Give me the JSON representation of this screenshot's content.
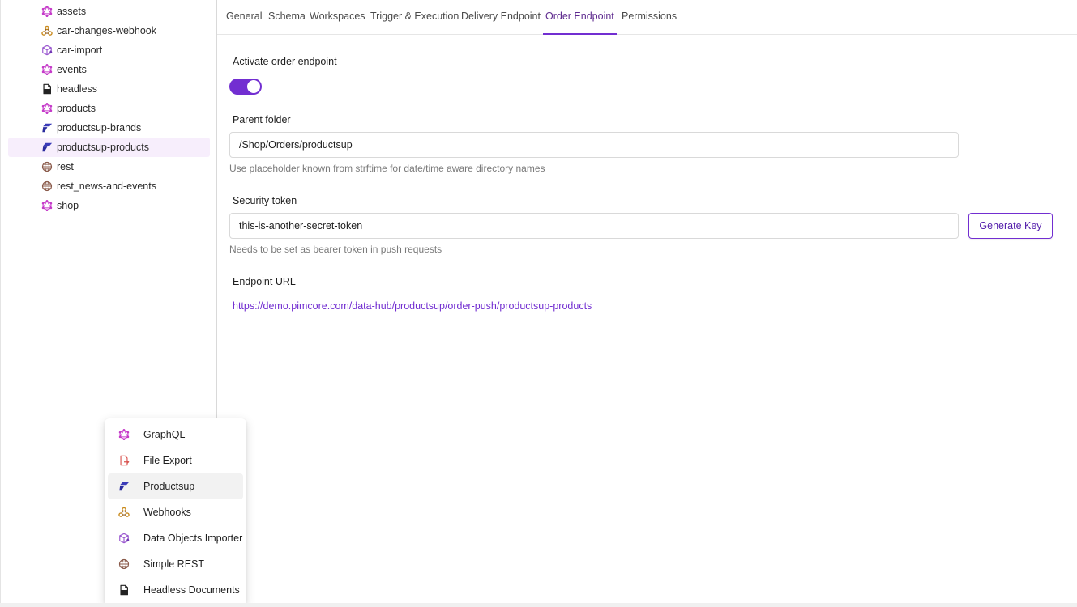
{
  "tree": {
    "items": [
      {
        "label": "assets",
        "icon": "graphql-icon"
      },
      {
        "label": "car-changes-webhook",
        "icon": "webhook-icon"
      },
      {
        "label": "car-import",
        "icon": "data-objects-importer-icon"
      },
      {
        "label": "events",
        "icon": "graphql-icon"
      },
      {
        "label": "headless",
        "icon": "document-icon"
      },
      {
        "label": "products",
        "icon": "graphql-icon"
      },
      {
        "label": "productsup-brands",
        "icon": "productsup-icon"
      },
      {
        "label": "productsup-products",
        "icon": "productsup-icon"
      },
      {
        "label": "rest",
        "icon": "globe-icon"
      },
      {
        "label": "rest_news-and-events",
        "icon": "globe-icon"
      },
      {
        "label": "shop",
        "icon": "graphql-icon"
      }
    ]
  },
  "tabs": [
    {
      "label": "General"
    },
    {
      "label": "Schema"
    },
    {
      "label": "Workspaces"
    },
    {
      "label": "Trigger & Execution"
    },
    {
      "label": "Delivery Endpoint"
    },
    {
      "label": "Order Endpoint"
    },
    {
      "label": "Permissions"
    }
  ],
  "form": {
    "activate_label": "Activate order endpoint",
    "activate_on": true,
    "parent_folder_label": "Parent folder",
    "parent_folder_value": "/Shop/Orders/productsup",
    "parent_folder_help": "Use placeholder known from strftime for date/time aware directory names",
    "security_token_label": "Security token",
    "security_token_value": "this-is-another-secret-token",
    "security_token_help": "Needs to be set as bearer token in push requests",
    "generate_key_label": "Generate Key",
    "endpoint_url_label": "Endpoint URL",
    "endpoint_url": "https://demo.pimcore.com/data-hub/productsup/order-push/productsup-products"
  },
  "menu": {
    "items": [
      {
        "label": "GraphQL",
        "icon": "graphql-icon"
      },
      {
        "label": "File Export",
        "icon": "file-export-icon"
      },
      {
        "label": "Productsup",
        "icon": "productsup-icon"
      },
      {
        "label": "Webhooks",
        "icon": "webhook-icon"
      },
      {
        "label": "Data Objects Importer",
        "icon": "data-objects-importer-icon"
      },
      {
        "label": "Simple REST",
        "icon": "globe-icon"
      },
      {
        "label": "Headless Documents",
        "icon": "document-icon"
      }
    ]
  },
  "colors": {
    "accent": "#722ed1",
    "selected_bg": "#f7eefc",
    "graphql": "#c53ac9",
    "productsup": "#3a3bb8",
    "webhook": "#c98a1c",
    "globe": "#8a5a4a"
  }
}
